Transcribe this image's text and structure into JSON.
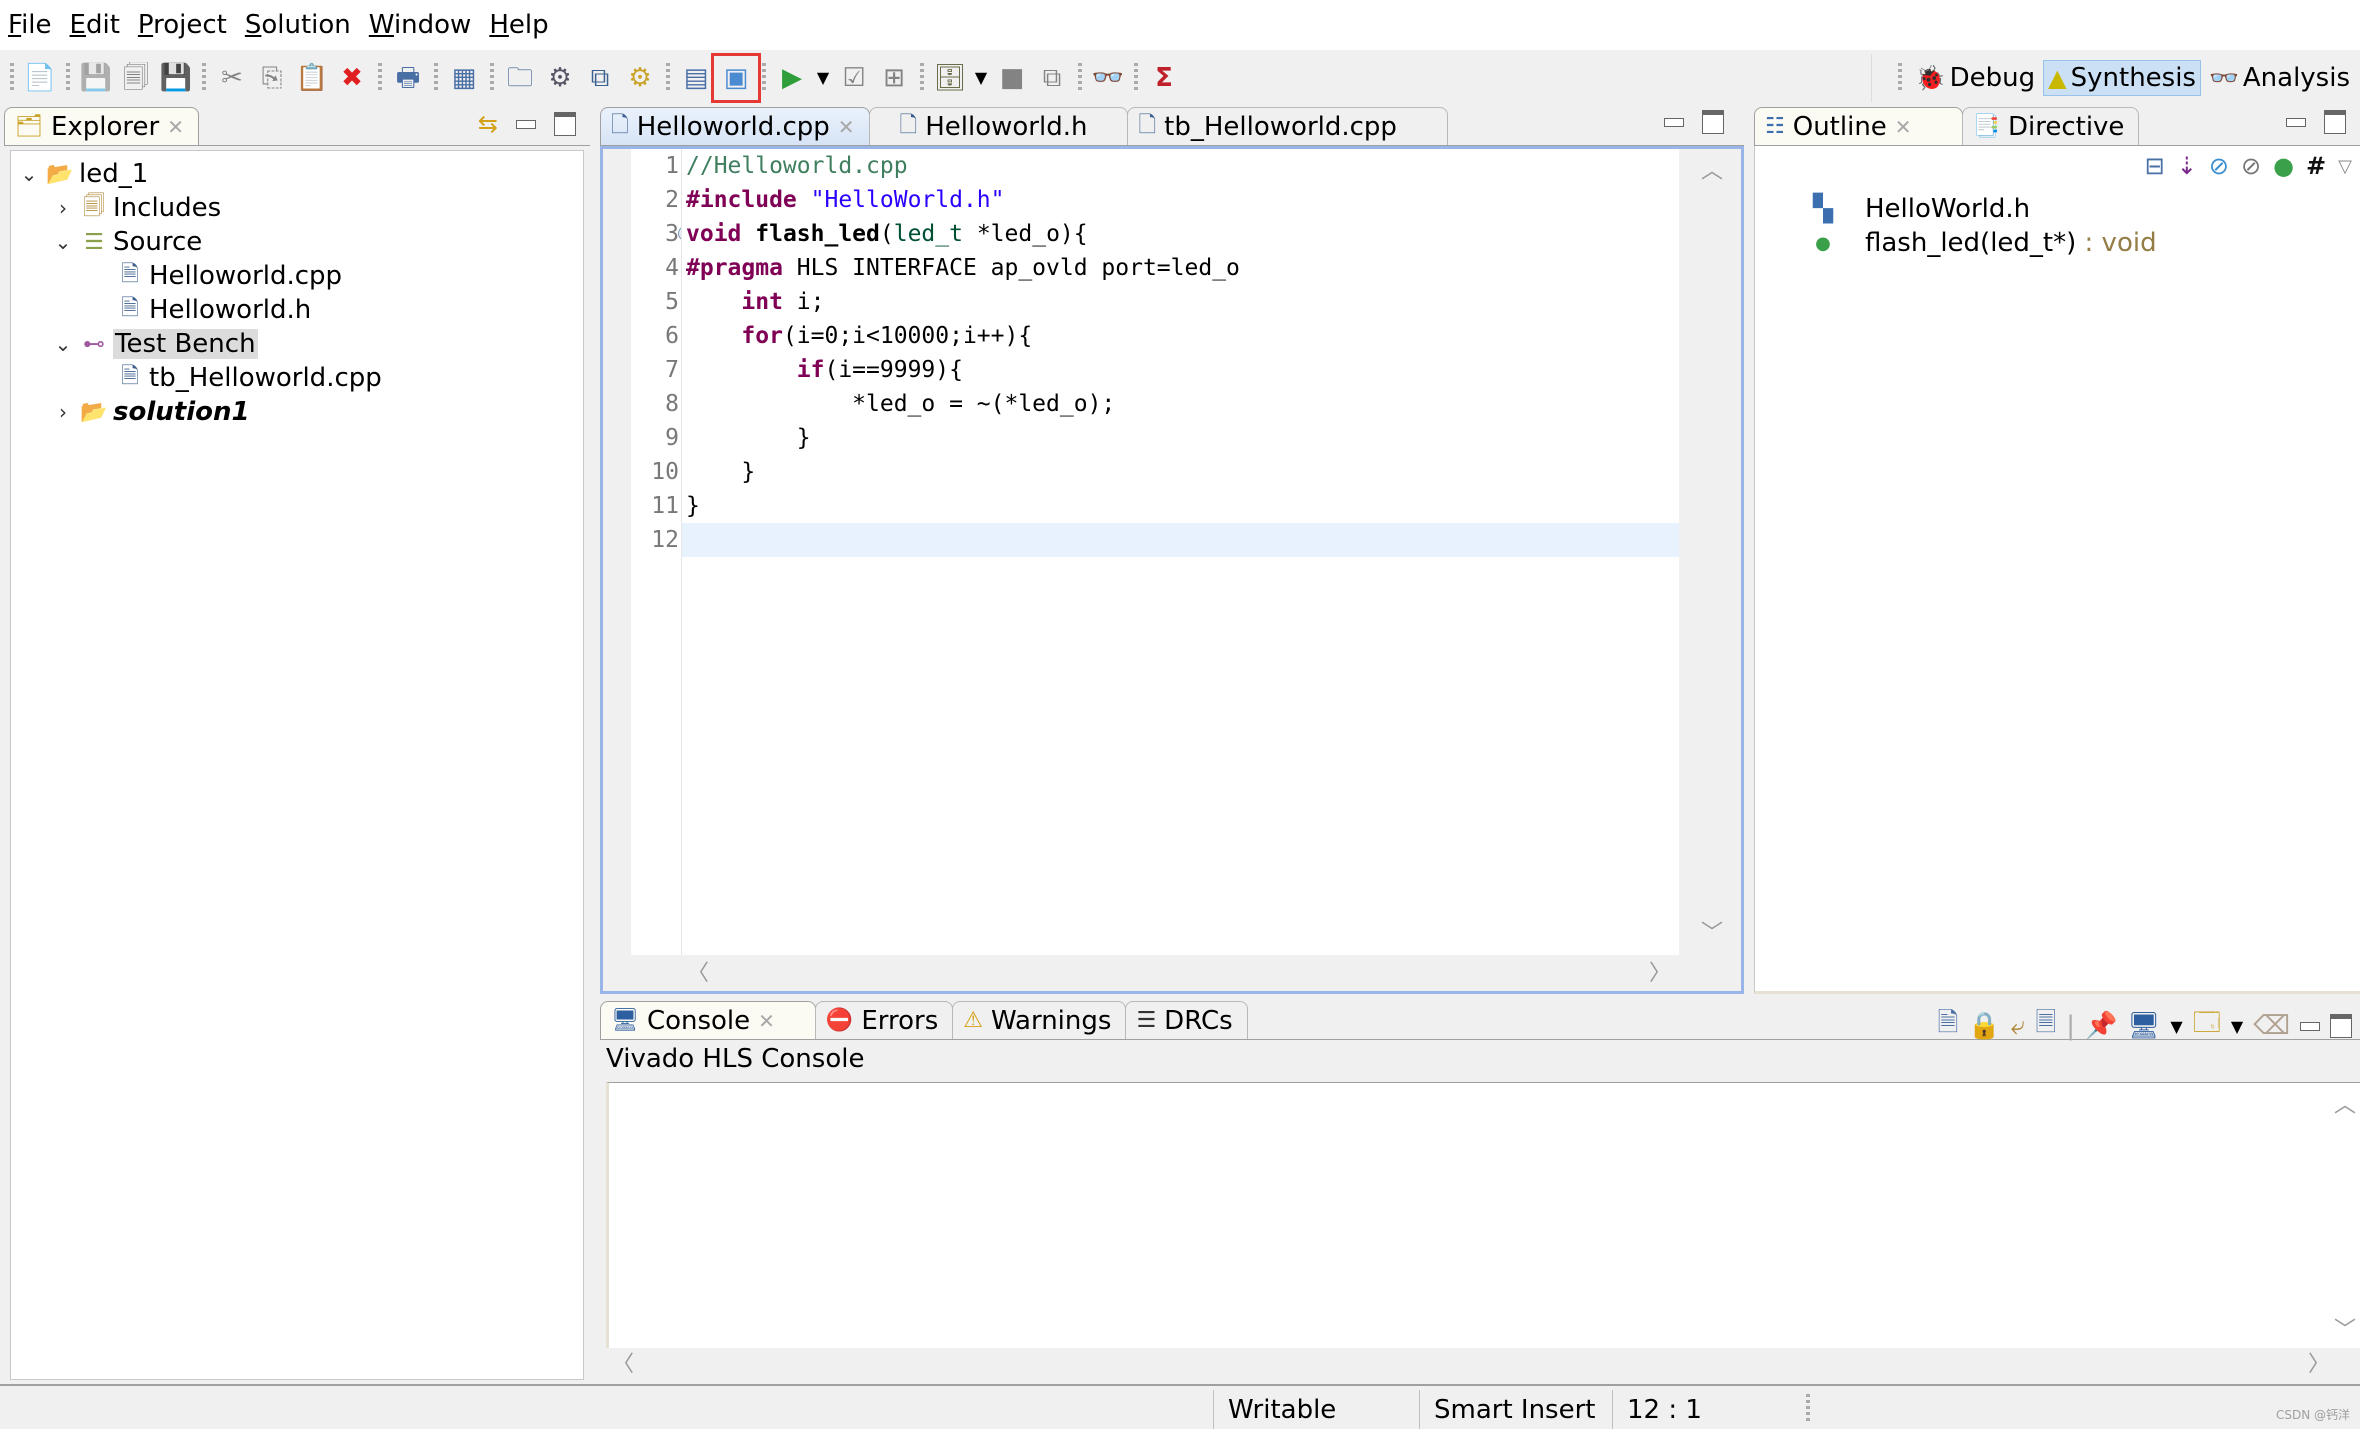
{
  "menubar": {
    "items": [
      {
        "label": "File",
        "mnemonic": "F",
        "rest": "ile"
      },
      {
        "label": "Edit",
        "mnemonic": "E",
        "rest": "dit"
      },
      {
        "label": "Project",
        "mnemonic": "P",
        "rest": "roject"
      },
      {
        "label": "Solution",
        "mnemonic": "S",
        "rest": "olution"
      },
      {
        "label": "Window",
        "mnemonic": "W",
        "rest": "indow"
      },
      {
        "label": "Help",
        "mnemonic": "H",
        "rest": "elp"
      }
    ]
  },
  "toolbar": {
    "icons": {
      "new": "📄",
      "save": "💾",
      "save_all": "🗐",
      "save_as": "💾",
      "cut": "✂",
      "copy": "⎘",
      "paste": "📋",
      "delete": "✖",
      "print": "🖶",
      "open_report": "▦",
      "new_solution": "🗀",
      "settings": "⚙",
      "directives": "⧉",
      "run_settings": "⚙",
      "open_waveform": "▤",
      "run_cosim_view": "▣",
      "run": "▶",
      "dropdown": "▼",
      "validate": "☑",
      "grid": "⊞",
      "export": "🗄",
      "stop": "■",
      "compare": "⧉",
      "analysis": "👓",
      "sigma": "Σ"
    },
    "perspectives": [
      {
        "label": "Debug",
        "icon": "🐞",
        "active": false
      },
      {
        "label": "Synthesis",
        "icon": "▲",
        "active": true
      },
      {
        "label": "Analysis",
        "icon": "👓",
        "active": false
      }
    ]
  },
  "explorer": {
    "tab_label": "Explorer",
    "tree": [
      {
        "label": "led_1",
        "expanded": true,
        "depth": 0
      },
      {
        "label": "Includes",
        "expanded": false,
        "depth": 1
      },
      {
        "label": "Source",
        "expanded": true,
        "depth": 1
      },
      {
        "label": "Helloworld.cpp",
        "depth": 2
      },
      {
        "label": "Helloworld.h",
        "depth": 2
      },
      {
        "label": "Test Bench",
        "expanded": true,
        "depth": 1,
        "selected": true
      },
      {
        "label": "tb_Helloworld.cpp",
        "depth": 2
      },
      {
        "label": "solution1",
        "expanded": false,
        "depth": 1
      }
    ]
  },
  "editor": {
    "tabs": [
      {
        "label": "Helloworld.cpp",
        "active": true
      },
      {
        "label": "Helloworld.h",
        "active": false
      },
      {
        "label": "tb_Helloworld.cpp",
        "active": false
      }
    ],
    "lines": [
      {
        "n": "1",
        "tokens": [
          {
            "t": "//Helloworld.cpp",
            "c": "cm"
          }
        ]
      },
      {
        "n": "2",
        "tokens": [
          {
            "t": "#include",
            "c": "kw"
          },
          {
            "t": " "
          },
          {
            "t": "\"HelloWorld.h\"",
            "c": "st"
          }
        ]
      },
      {
        "n": "3",
        "tokens": [
          {
            "t": "void",
            "c": "kw"
          },
          {
            "t": " "
          },
          {
            "t": "flash_led",
            "c": "fn"
          },
          {
            "t": "("
          },
          {
            "t": "led_t",
            "c": "ty"
          },
          {
            "t": " *led_o){"
          }
        ]
      },
      {
        "n": "4",
        "tokens": [
          {
            "t": "#pragma",
            "c": "kw"
          },
          {
            "t": " HLS INTERFACE ap_ovld port=led_o"
          }
        ]
      },
      {
        "n": "5",
        "tokens": [
          {
            "t": "    "
          },
          {
            "t": "int",
            "c": "kw"
          },
          {
            "t": " i;"
          }
        ]
      },
      {
        "n": "6",
        "tokens": [
          {
            "t": "    "
          },
          {
            "t": "for",
            "c": "kw"
          },
          {
            "t": "(i=0;i<10000;i++){"
          }
        ]
      },
      {
        "n": "7",
        "tokens": [
          {
            "t": "        "
          },
          {
            "t": "if",
            "c": "kw"
          },
          {
            "t": "(i==9999){"
          }
        ]
      },
      {
        "n": "8",
        "tokens": [
          {
            "t": "            *led_o = ~(*led_o);"
          }
        ]
      },
      {
        "n": "9",
        "tokens": [
          {
            "t": "        }"
          }
        ]
      },
      {
        "n": "10",
        "tokens": [
          {
            "t": "    }"
          }
        ]
      },
      {
        "n": "11",
        "tokens": [
          {
            "t": "}"
          }
        ]
      },
      {
        "n": "12",
        "tokens": [
          {
            "t": ""
          }
        ],
        "current": true
      }
    ]
  },
  "outline": {
    "tabs": [
      {
        "label": "Outline",
        "active": true
      },
      {
        "label": "Directive",
        "active": false
      }
    ],
    "items": [
      {
        "label": "HelloWorld.h",
        "suffix": ""
      },
      {
        "label": "flash_led(led_t*)",
        "suffix": " : void"
      }
    ]
  },
  "console": {
    "tabs": [
      {
        "label": "Console",
        "active": true
      },
      {
        "label": "Errors",
        "active": false
      },
      {
        "label": "Warnings",
        "active": false
      },
      {
        "label": "DRCs",
        "active": false
      }
    ],
    "title": "Vivado HLS Console"
  },
  "statusbar": {
    "mode": "Writable",
    "insert": "Smart Insert",
    "position": "12 : 1",
    "watermark": "CSDN @钙洋"
  },
  "colors": {
    "keyword": "#7f0055",
    "comment": "#3f7f5f",
    "string": "#2a00ff",
    "highlight_box": "#e53935",
    "current_line": "#e8f2fe",
    "active_frame": "#99b4e6"
  }
}
